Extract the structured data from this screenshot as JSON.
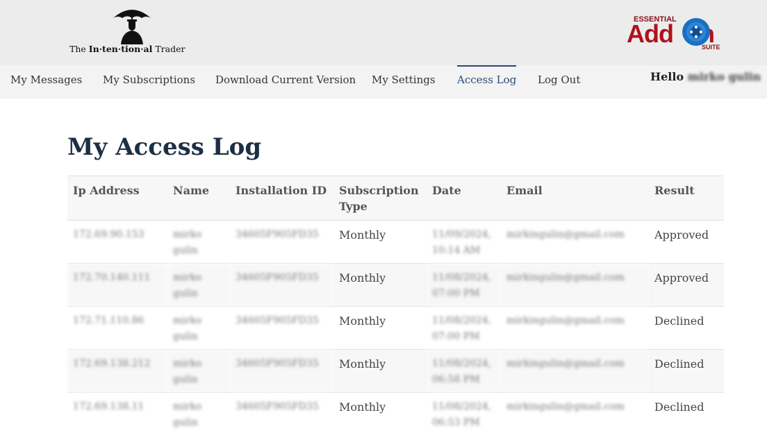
{
  "brand": {
    "left_logo": {
      "prefix": "The ",
      "bold": "In·ten·tion·al",
      "suffix": " Trader"
    },
    "right_logo": {
      "top": "ESSENTIAL",
      "main_before": "Add",
      "main_after": "n",
      "bottom": "SUITE"
    }
  },
  "nav": {
    "items": [
      {
        "label": "My Messages"
      },
      {
        "label": "My Subscriptions"
      },
      {
        "label": "Download Current Version"
      },
      {
        "label": "My Settings"
      },
      {
        "label": "Access Log",
        "active": true
      },
      {
        "label": "Log Out"
      }
    ],
    "greeting": "Hello",
    "user": "mirko gulin"
  },
  "page": {
    "title": "My Access Log"
  },
  "table": {
    "headers": [
      "Ip Address",
      "Name",
      "Installation ID",
      "Subscription Type",
      "Date",
      "Email",
      "Result"
    ],
    "rows": [
      {
        "ip": "172.69.90.153",
        "name": "mirko gulin",
        "install_id": "34605F905FD35",
        "type": "Monthly",
        "date": "11/09/2024, 10:14 AM",
        "email": "mirkingulin@gmail.com",
        "result": "Approved"
      },
      {
        "ip": "172.70.140.111",
        "name": "mirko gulin",
        "install_id": "34605F905FD35",
        "type": "Monthly",
        "date": "11/08/2024, 07:00 PM",
        "email": "mirkingulin@gmail.com",
        "result": "Approved"
      },
      {
        "ip": "172.71.110.86",
        "name": "mirko gulin",
        "install_id": "34605F905FD35",
        "type": "Monthly",
        "date": "11/08/2024, 07:00 PM",
        "email": "mirkingulin@gmail.com",
        "result": "Declined"
      },
      {
        "ip": "172.69.138.212",
        "name": "mirko gulin",
        "install_id": "34605F905FD35",
        "type": "Monthly",
        "date": "11/08/2024, 06:58 PM",
        "email": "mirkingulin@gmail.com",
        "result": "Declined"
      },
      {
        "ip": "172.69.138.11",
        "name": "mirko gulin",
        "install_id": "34605F905FD35",
        "type": "Monthly",
        "date": "11/08/2024, 06:53 PM",
        "email": "mirkingulin@gmail.com",
        "result": "Declined"
      }
    ]
  },
  "colors": {
    "accent": "#2a4a78",
    "title": "#1c2f45",
    "brand_red": "#b0121b",
    "brand_blue": "#1a6fc0"
  }
}
